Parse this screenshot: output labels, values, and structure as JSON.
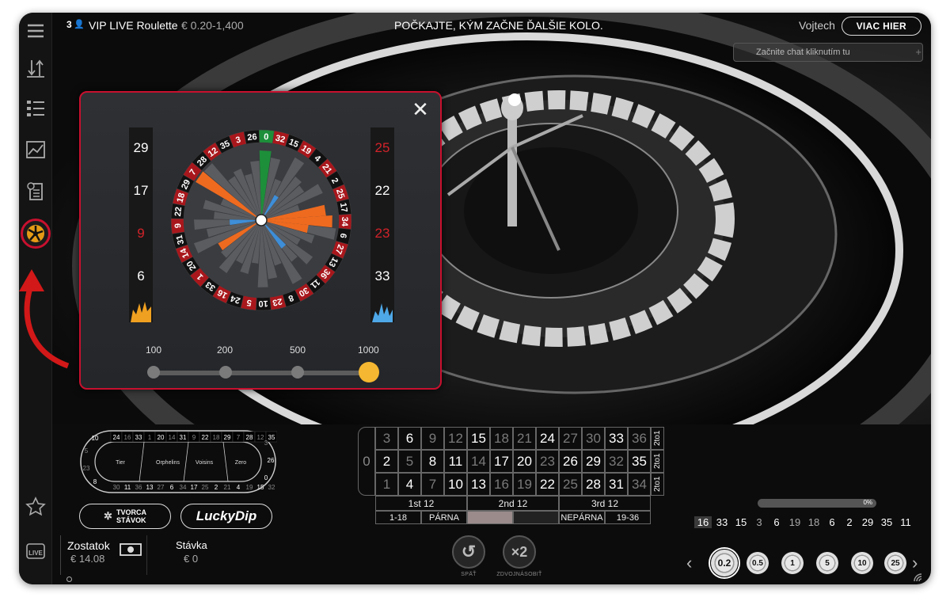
{
  "topbar": {
    "player_count": "3",
    "game_title": "VIP LIVE Roulette",
    "bet_limits": "€ 0.20-1,400",
    "status_message": "POČKAJTE, KÝM ZAČNE ĎALŠIE KOLO.",
    "username": "Vojtech",
    "more_games_label": "VIAC HIER"
  },
  "chat": {
    "placeholder": "Začnite chat kliknutím tu",
    "plus": "+"
  },
  "stats_popup": {
    "close_label": "✕",
    "cold_numbers": [
      "29",
      "17",
      "9",
      "6"
    ],
    "hot_numbers": [
      "25",
      "22",
      "23",
      "33"
    ],
    "wheel_numbers": [
      "0",
      "32",
      "15",
      "19",
      "4",
      "21",
      "2",
      "25",
      "17",
      "34",
      "6",
      "27",
      "13",
      "36",
      "11",
      "30",
      "8",
      "23",
      "10",
      "5",
      "24",
      "16",
      "33",
      "1",
      "20",
      "14",
      "31",
      "9",
      "22",
      "18",
      "29",
      "7",
      "28",
      "12",
      "35",
      "3",
      "26"
    ],
    "slider_options": [
      "100",
      "200",
      "500",
      "1000"
    ],
    "slider_selected": "1000",
    "colors": {
      "red": "#a8171c",
      "black": "#111111",
      "green": "#1d8f3a",
      "hot_orange": "#ee6a1f",
      "cold_blue": "#3e8ed8",
      "accent": "#c8102e"
    }
  },
  "racetrack": {
    "top_row": [
      "24",
      "16",
      "33",
      "1",
      "20",
      "14",
      "31",
      "9",
      "22",
      "18",
      "29",
      "7",
      "28",
      "12",
      "35"
    ],
    "bottom_row": [
      "30",
      "11",
      "36",
      "13",
      "27",
      "6",
      "34",
      "17",
      "25",
      "2",
      "21",
      "4",
      "19",
      "15",
      "32"
    ],
    "left_end": [
      "10",
      "5",
      "23",
      "8"
    ],
    "right_end": [
      "3",
      "26",
      "0"
    ],
    "sections": [
      "Tier",
      "Orphelins",
      "Voisins",
      "Zero"
    ]
  },
  "buttons": {
    "favorite_creator_line1": "TVORCA",
    "favorite_creator_line2": "STÁVOK",
    "lucky_dip": "LuckyDip",
    "undo_label": "SPÄŤ",
    "double_label": "ZDVOJNÁSOBIŤ",
    "double_symbol": "×2"
  },
  "bet_grid": {
    "zero": "0",
    "rows": [
      [
        "3",
        "6",
        "9",
        "12",
        "15",
        "18",
        "21",
        "24",
        "27",
        "30",
        "33",
        "36"
      ],
      [
        "2",
        "5",
        "8",
        "11",
        "14",
        "17",
        "20",
        "23",
        "26",
        "29",
        "32",
        "35"
      ],
      [
        "1",
        "4",
        "7",
        "10",
        "13",
        "16",
        "19",
        "22",
        "25",
        "28",
        "31",
        "34"
      ]
    ],
    "column_bets": [
      "2to1",
      "2to1",
      "2to1"
    ],
    "dozens": [
      "1st 12",
      "2nd 12",
      "3rd 12"
    ],
    "outside": [
      "1-18",
      "PÁRNA",
      "",
      "",
      "NEPÁRNA",
      "19-36"
    ]
  },
  "balance": {
    "label": "Zostatok",
    "value": "€ 14.08"
  },
  "bet": {
    "label": "Stávka",
    "value": "€ 0"
  },
  "progress": {
    "label": "0%",
    "value": 0
  },
  "history": [
    "16",
    "33",
    "15",
    "3",
    "6",
    "19",
    "18",
    "6",
    "2",
    "29",
    "35",
    "11"
  ],
  "chips": [
    "0.2",
    "0.5",
    "1",
    "5",
    "10",
    "25"
  ],
  "selected_chip": "0.2",
  "sidebar_icons": [
    "menu-icon",
    "sort-icon",
    "list-icon",
    "chart-icon",
    "receipt-icon",
    "statistics-wheel-icon",
    "star-icon",
    "playtech-live-icon"
  ],
  "sidebar_live_label": "LIVE"
}
